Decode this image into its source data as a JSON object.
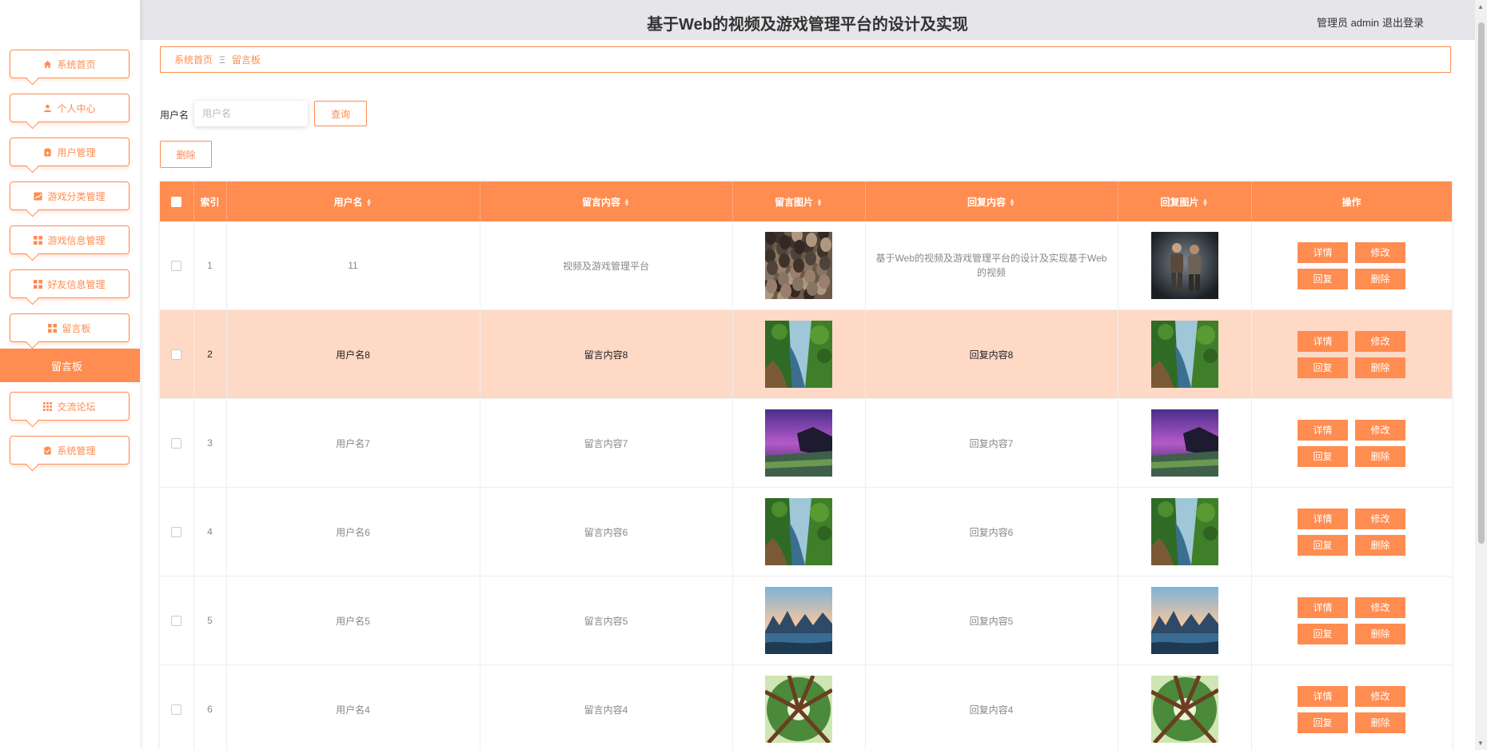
{
  "header": {
    "title": "基于Web的视频及游戏管理平台的设计及实现",
    "user": "管理员 admin",
    "logout": "退出登录"
  },
  "sidebar": {
    "items": [
      {
        "label": "系统首页",
        "icon": "home-icon"
      },
      {
        "label": "个人中心",
        "icon": "user-icon"
      },
      {
        "label": "用户管理",
        "icon": "clipboard-icon"
      },
      {
        "label": "游戏分类管理",
        "icon": "chart-icon"
      },
      {
        "label": "游戏信息管理",
        "icon": "grid-icon"
      },
      {
        "label": "好友信息管理",
        "icon": "grid-icon"
      },
      {
        "label": "留言板",
        "icon": "grid-icon"
      },
      {
        "label": "交流论坛",
        "icon": "apps-icon"
      },
      {
        "label": "系统管理",
        "icon": "clipboard-icon"
      }
    ],
    "active_label": "留言板"
  },
  "breadcrumb": {
    "home": "系统首页",
    "separator": "Ξ",
    "current": "留言板"
  },
  "search": {
    "label": "用户名",
    "placeholder": "用户名",
    "button": "查询"
  },
  "actions": {
    "delete": "删除"
  },
  "table": {
    "columns": [
      "索引",
      "用户名",
      "留言内容",
      "留言图片",
      "回复内容",
      "回复图片",
      "操作"
    ],
    "sortable": [
      "用户名",
      "留言内容",
      "留言图片",
      "回复内容",
      "回复图片"
    ],
    "row_buttons": [
      "详情",
      "修改",
      "回复",
      "删除"
    ],
    "rows": [
      {
        "index": "1",
        "username": "11",
        "message": "视频及游戏管理平台",
        "msg_image": "crowd-image",
        "reply": "基于Web的视频及游戏管理平台的设计及实现基于Web的视频",
        "reply_image": "game-character-image"
      },
      {
        "index": "2",
        "username": "用户名8",
        "message": "留言内容8",
        "msg_image": "forest-river-image",
        "reply": "回复内容8",
        "reply_image": "forest-river-image",
        "highlighted": true
      },
      {
        "index": "3",
        "username": "用户名7",
        "message": "留言内容7",
        "msg_image": "purple-coast-image",
        "reply": "回复内容7",
        "reply_image": "purple-coast-image"
      },
      {
        "index": "4",
        "username": "用户名6",
        "message": "留言内容6",
        "msg_image": "forest-river-image",
        "reply": "回复内容6",
        "reply_image": "forest-river-image"
      },
      {
        "index": "5",
        "username": "用户名5",
        "message": "留言内容5",
        "msg_image": "karst-mountains-image",
        "reply": "回复内容5",
        "reply_image": "karst-mountains-image"
      },
      {
        "index": "6",
        "username": "用户名4",
        "message": "留言内容4",
        "msg_image": "tree-canopy-image",
        "reply": "回复内容4",
        "reply_image": "tree-canopy-image"
      }
    ]
  },
  "colors": {
    "accent": "#ff8c50",
    "highlight_row": "#fed9c6",
    "header_bg": "#e6e5e9"
  }
}
